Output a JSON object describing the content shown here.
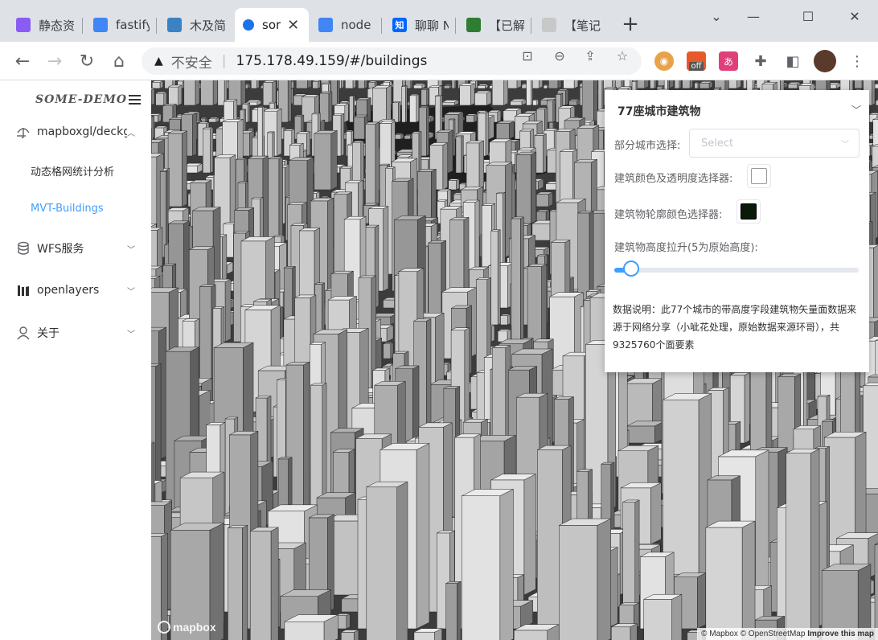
{
  "browser": {
    "tabs": [
      {
        "title": "静态资",
        "favicon": "vite-icon",
        "color": "#8a5cf6"
      },
      {
        "title": "fastify",
        "favicon": "google-icon",
        "color": "#4285f4"
      },
      {
        "title": "木及简",
        "favicon": "app-icon",
        "color": "#3b82c4"
      },
      {
        "title": "sor",
        "favicon": "dot-icon",
        "color": "#1a73e8",
        "active": true
      },
      {
        "title": "node",
        "favicon": "google-icon",
        "color": "#4285f4"
      },
      {
        "title": "聊聊 N",
        "favicon": "zhihu-icon",
        "color": "#0066ff",
        "badge": "知"
      },
      {
        "title": "【已解",
        "favicon": "shield-icon",
        "color": "#2e7d32"
      },
      {
        "title": "【笔记",
        "favicon": "leaf-icon",
        "color": "#c8c8c8"
      }
    ],
    "close_glyph": "✕",
    "new_tab_glyph": "+",
    "omnibox": {
      "security_label": "不安全",
      "url": "175.178.49.159/#/buildings"
    },
    "extension_badge": "off"
  },
  "sidebar": {
    "logo": "SOME-DEMO",
    "menus": [
      {
        "label": "mapboxgl/deckgl",
        "icon": "umbrella-icon",
        "expanded": true
      },
      {
        "label": "WFS服务",
        "icon": "database-icon",
        "expanded": false
      },
      {
        "label": "openlayers",
        "icon": "library-icon",
        "expanded": false
      },
      {
        "label": "关于",
        "icon": "user-icon",
        "expanded": false
      }
    ],
    "submenu": [
      {
        "label": "动态格网统计分析",
        "active": false
      },
      {
        "label": "MVT-Buildings",
        "active": true
      }
    ]
  },
  "map": {
    "attribution": {
      "mapbox": "© Mapbox",
      "osm": "© OpenStreetMap",
      "improve": "Improve this map"
    },
    "logo_text": "mapbox"
  },
  "panel": {
    "title": "77座城市建筑物",
    "city_select_label": "部分城市选择:",
    "city_select_placeholder": "Select",
    "fill_color_label": "建筑颜色及透明度选择器:",
    "fill_color": "#ffffff",
    "outline_color_label": "建筑物轮廓颜色选择器:",
    "outline_color": "#0a1a0a",
    "height_label": "建筑物高度拉升(5为原始高度):",
    "height_slider_fraction": 0.07,
    "description": "数据说明：此77个城市的带高度字段建筑物矢量面数据来源于网络分享（小呲花处理，原始数据来源环哥），共9325760个面要素"
  },
  "colors": {
    "accent": "#409eff",
    "tab_strip": "#dee1e6"
  }
}
